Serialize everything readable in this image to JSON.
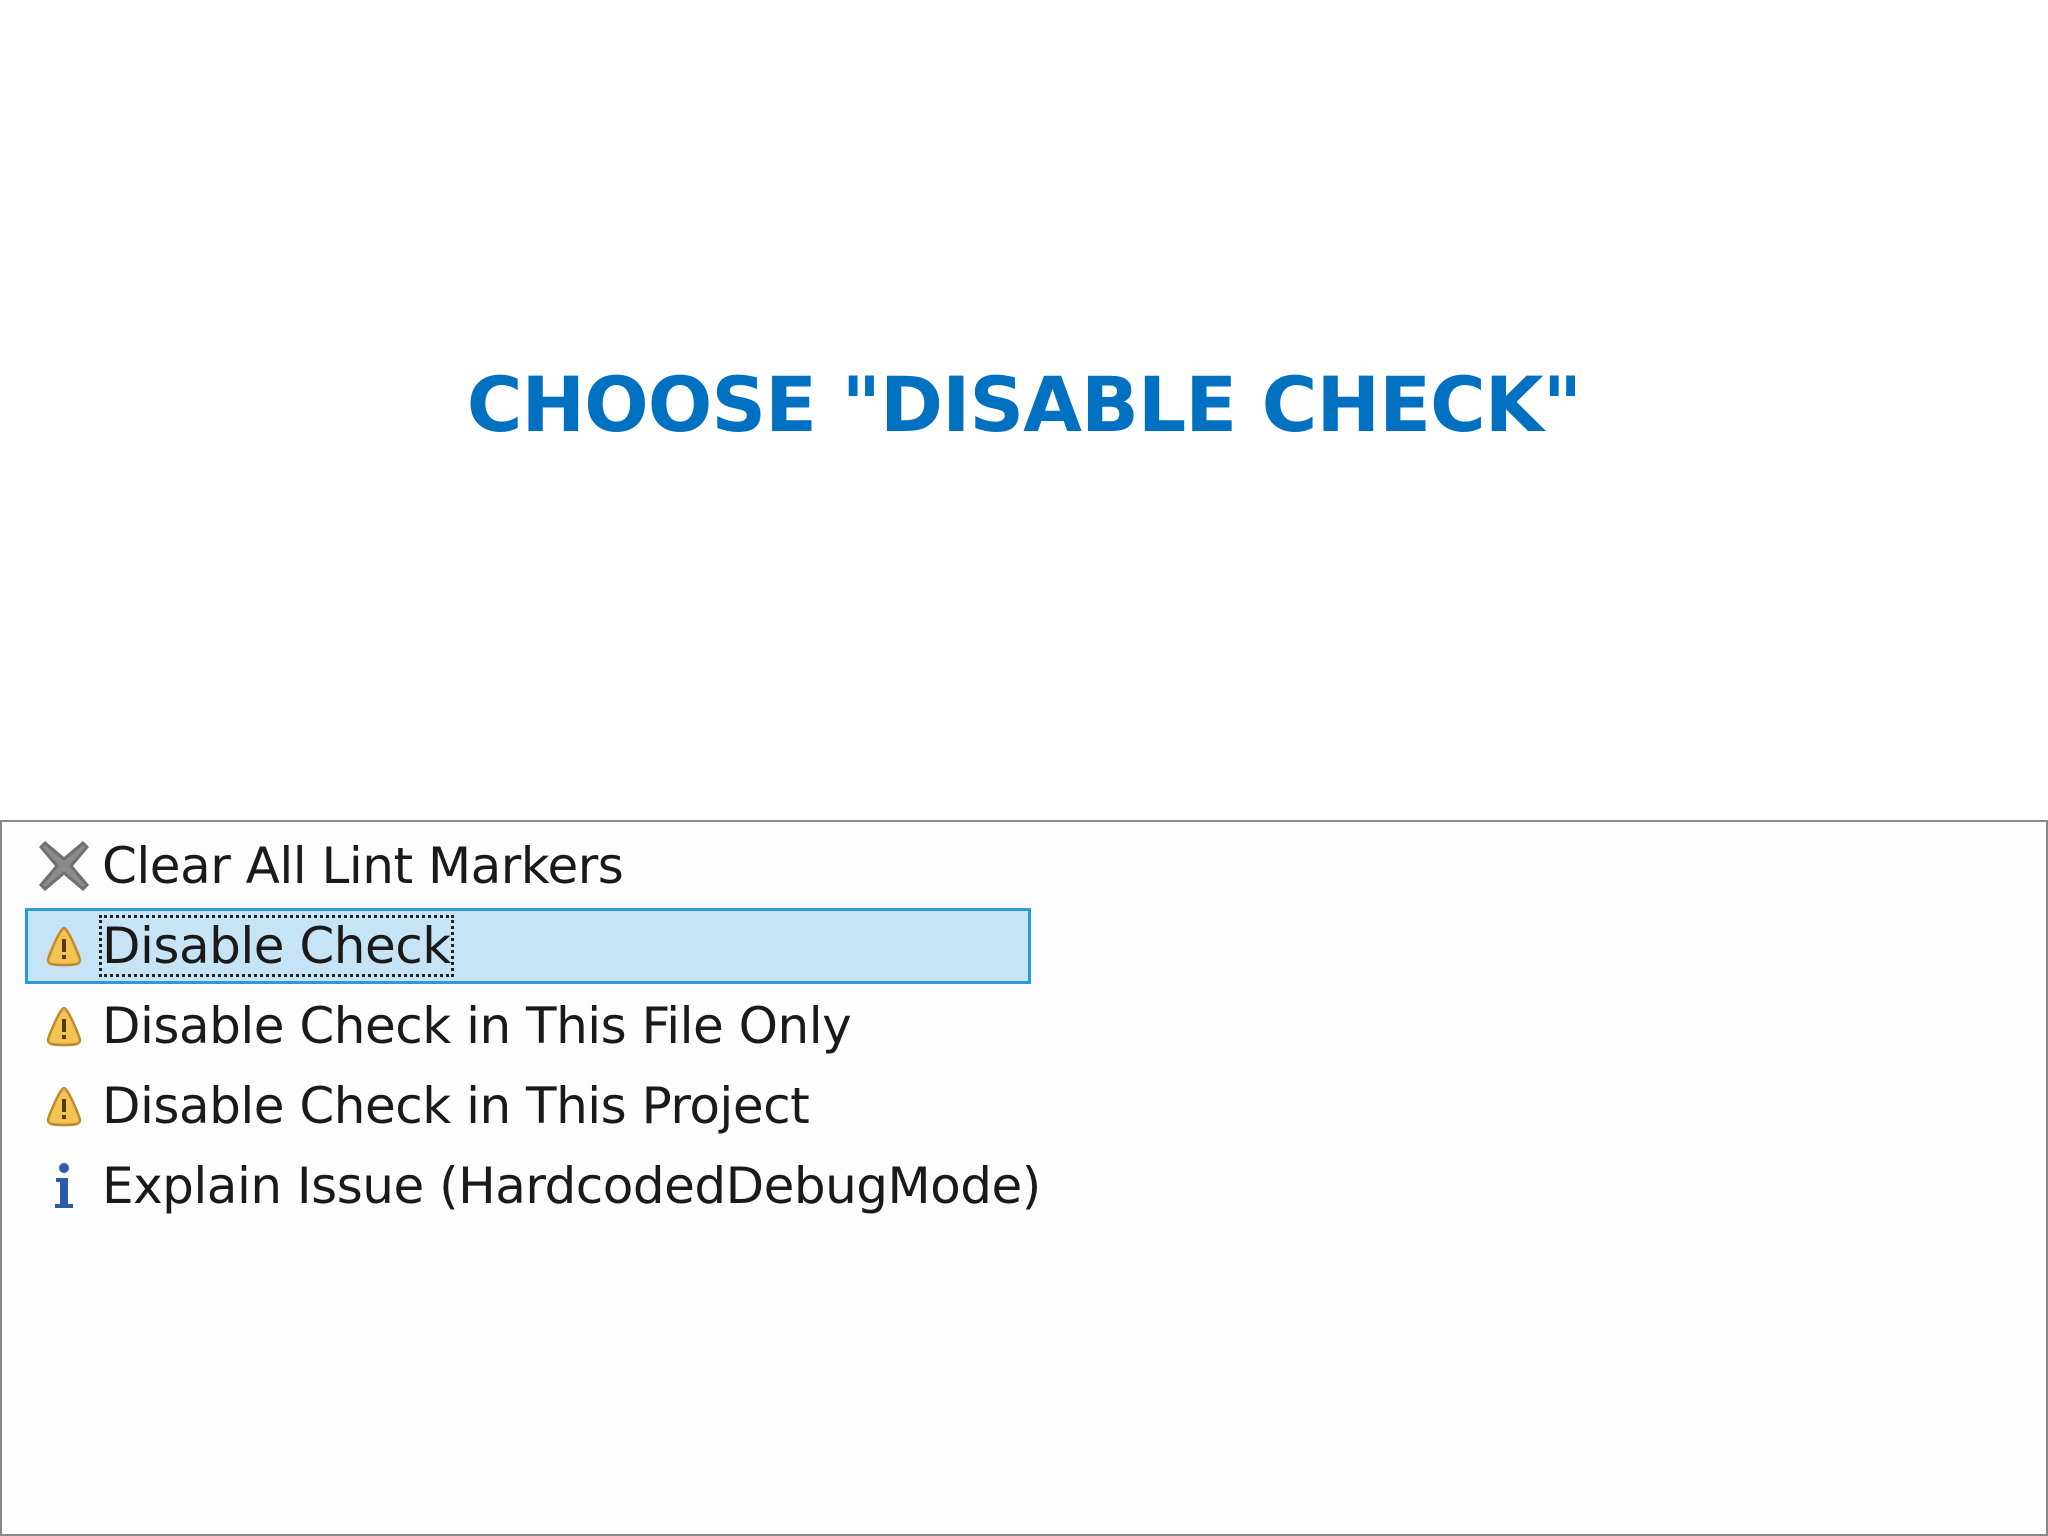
{
  "slide": {
    "title": "CHOOSE \"DISABLE CHECK\""
  },
  "menu": {
    "items": [
      {
        "label": "Clear All Lint Markers",
        "icon": "clear-x-icon",
        "selected": false
      },
      {
        "label": "Disable Check",
        "icon": "warning-icon",
        "selected": true
      },
      {
        "label": "Disable Check in This File Only",
        "icon": "warning-icon",
        "selected": false
      },
      {
        "label": "Disable Check in This Project",
        "icon": "warning-icon",
        "selected": false
      },
      {
        "label": "Explain Issue (HardcodedDebugMode)",
        "icon": "info-icon",
        "selected": false
      }
    ]
  },
  "colors": {
    "title": "#0070c0",
    "selection_fill": "#c6e4f6",
    "selection_border": "#2b9bd6",
    "warning_fill": "#f3c453",
    "info": "#2a5caa"
  }
}
